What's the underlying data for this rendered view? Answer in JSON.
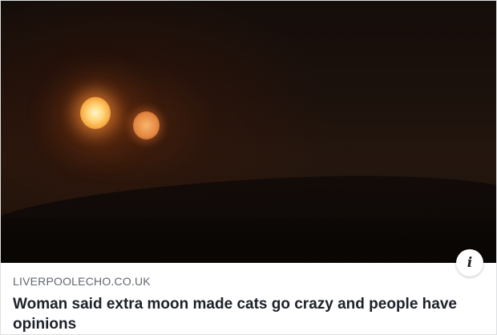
{
  "link_preview": {
    "domain": "LIVERPOOLECHO.CO.UK",
    "headline": "Woman said extra moon made cats go crazy and people have opinions",
    "info_icon_glyph": "i",
    "info_icon_name": "info-icon"
  },
  "colors": {
    "caption_background": "#ffffff",
    "domain_text": "#606770",
    "headline_text": "#1d2129"
  }
}
